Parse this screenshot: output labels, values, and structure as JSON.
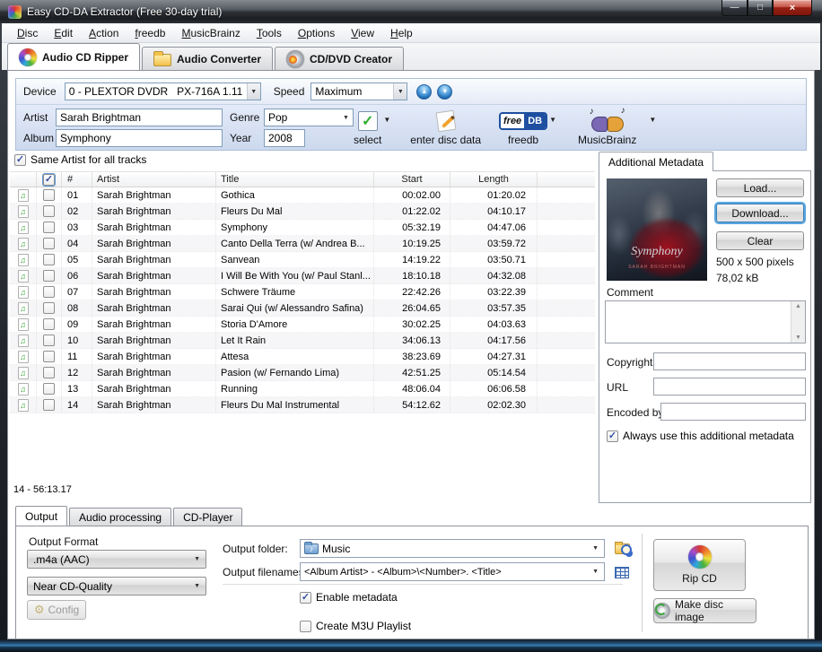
{
  "window": {
    "title": "Easy CD-DA Extractor (Free 30-day trial)"
  },
  "menu": {
    "items": [
      "Disc",
      "Edit",
      "Action",
      "freedb",
      "MusicBrainz",
      "Tools",
      "Options",
      "View",
      "Help"
    ]
  },
  "main_tabs": [
    {
      "label": "Audio CD Ripper",
      "icon": "cd-icon",
      "active": true
    },
    {
      "label": "Audio Converter",
      "icon": "folder-icon",
      "active": false
    },
    {
      "label": "CD/DVD Creator",
      "icon": "disc-burn-icon",
      "active": false
    }
  ],
  "device_bar": {
    "device_label": "Device",
    "device_value": "0 - PLEXTOR DVDR   PX-716A 1.11",
    "speed_label": "Speed",
    "speed_value": "Maximum",
    "icons": [
      "eject-up-button",
      "load-down-button"
    ]
  },
  "disc_info": {
    "artist_label": "Artist",
    "artist": "Sarah Brightman",
    "genre_label": "Genre",
    "genre": "Pop",
    "album_label": "Album",
    "album": "Symphony",
    "year_label": "Year",
    "year": "2008"
  },
  "toolbar": {
    "select_label": "select",
    "enter_disc_data_label": "enter disc data",
    "freedb_label": "freedb",
    "freedb_logo_left": "free",
    "freedb_logo_right": "DB",
    "musicbrainz_label": "MusicBrainz",
    "icons": [
      "select-check-icon",
      "pencil-page-icon",
      "freedb-logo",
      "brain-icon",
      "dropdown-arrow"
    ]
  },
  "tracklist": {
    "same_artist_label": "Same Artist for all tracks",
    "same_artist_checked": true,
    "columns": {
      "number": "#",
      "artist": "Artist",
      "title": "Title",
      "start": "Start",
      "length": "Length"
    },
    "rows": [
      {
        "num": "01",
        "artist": "Sarah Brightman",
        "title": "Gothica",
        "start": "00:02.00",
        "length": "01:20.02"
      },
      {
        "num": "02",
        "artist": "Sarah Brightman",
        "title": "Fleurs Du Mal",
        "start": "01:22.02",
        "length": "04:10.17"
      },
      {
        "num": "03",
        "artist": "Sarah Brightman",
        "title": "Symphony",
        "start": "05:32.19",
        "length": "04:47.06"
      },
      {
        "num": "04",
        "artist": "Sarah Brightman",
        "title": "Canto Della Terra (w/ Andrea B...",
        "start": "10:19.25",
        "length": "03:59.72"
      },
      {
        "num": "05",
        "artist": "Sarah Brightman",
        "title": "Sanvean",
        "start": "14:19.22",
        "length": "03:50.71"
      },
      {
        "num": "06",
        "artist": "Sarah Brightman",
        "title": "I Will Be With You (w/ Paul Stanl...",
        "start": "18:10.18",
        "length": "04:32.08"
      },
      {
        "num": "07",
        "artist": "Sarah Brightman",
        "title": "Schwere Träume",
        "start": "22:42.26",
        "length": "03:22.39"
      },
      {
        "num": "08",
        "artist": "Sarah Brightman",
        "title": "Sarai Qui (w/ Alessandro Safina)",
        "start": "26:04.65",
        "length": "03:57.35"
      },
      {
        "num": "09",
        "artist": "Sarah Brightman",
        "title": "Storia D'Amore",
        "start": "30:02.25",
        "length": "04:03.63"
      },
      {
        "num": "10",
        "artist": "Sarah Brightman",
        "title": "Let It Rain",
        "start": "34:06.13",
        "length": "04:17.56"
      },
      {
        "num": "11",
        "artist": "Sarah Brightman",
        "title": "Attesa",
        "start": "38:23.69",
        "length": "04:27.31"
      },
      {
        "num": "12",
        "artist": "Sarah Brightman",
        "title": "Pasion (w/ Fernando Lima)",
        "start": "42:51.25",
        "length": "05:14.54"
      },
      {
        "num": "13",
        "artist": "Sarah Brightman",
        "title": "Running",
        "start": "48:06.04",
        "length": "06:06.58"
      },
      {
        "num": "14",
        "artist": "Sarah Brightman",
        "title": "Fleurs Du Mal Instrumental",
        "start": "54:12.62",
        "length": "02:02.30"
      }
    ],
    "status": "14 - 56:13.17"
  },
  "metadata_panel": {
    "tab_label": "Additional Metadata",
    "load_label": "Load...",
    "download_label": "Download...",
    "clear_label": "Clear",
    "dimensions": "500 x 500 pixels",
    "filesize": "78,02 kB",
    "cover": {
      "title": "Symphony",
      "artist": "SARAH BRIGHTMAN"
    },
    "comment_label": "Comment",
    "copyright_label": "Copyright",
    "url_label": "URL",
    "encoded_by_label": "Encoded by",
    "always_use_label": "Always use this additional metadata",
    "always_use_checked": true
  },
  "bottom_tabs": [
    "Output",
    "Audio processing",
    "CD-Player"
  ],
  "output_panel": {
    "output_format_label": "Output Format",
    "format_value": ".m4a (AAC)",
    "quality_value": "Near CD-Quality",
    "config_label": "Config",
    "output_folder_label": "Output folder:",
    "output_folder_value": "Music",
    "output_filenames_label": "Output filenames:",
    "output_filenames_value": "<Album Artist> - <Album>\\<Number>. <Title>",
    "enable_metadata_label": "Enable metadata",
    "enable_metadata_checked": true,
    "create_m3u_label": "Create M3U Playlist",
    "create_m3u_checked": false,
    "rip_cd_label": "Rip CD",
    "make_disc_image_label": "Make disc image",
    "icons": [
      "folder-search-icon",
      "filename-grid-icon",
      "gear-icon",
      "music-folder-icon",
      "cd-icon",
      "disc-image-icon"
    ]
  },
  "colors": {
    "freedb_blue": "#1e4fa0",
    "select_check_green": "#2eae2e",
    "download_focus_blue": "#58a6e0",
    "close_button_red": "#991f12",
    "panel_blue": "#ccd9ee"
  }
}
